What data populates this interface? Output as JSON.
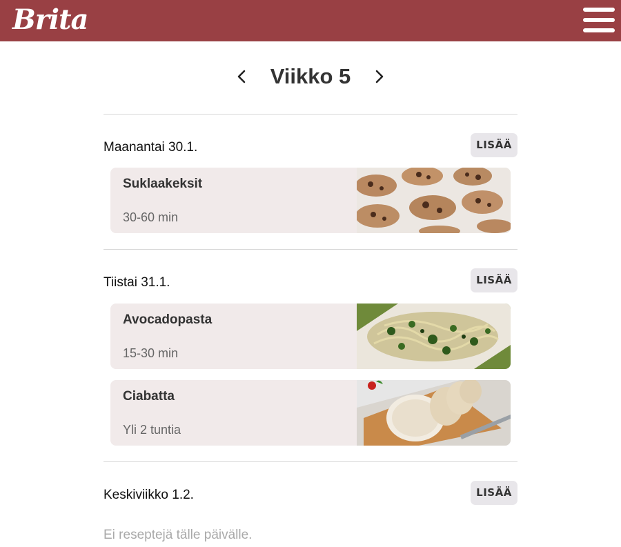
{
  "header": {
    "logo_text": "Brita",
    "menu_icon": "hamburger-menu-icon",
    "background_color": "#994044"
  },
  "week_nav": {
    "title": "Viikko 5",
    "prev_icon": "chevron-left-icon",
    "next_icon": "chevron-right-icon"
  },
  "days": [
    {
      "label": "Maanantai 30.1.",
      "add_label": "LISÄÄ",
      "recipes": [
        {
          "title": "Suklaakeksit",
          "time": "30-60 min",
          "image": "chocolate-cookies-image"
        }
      ]
    },
    {
      "label": "Tiistai 31.1.",
      "add_label": "LISÄÄ",
      "recipes": [
        {
          "title": "Avocadopasta",
          "time": "15-30 min",
          "image": "avocado-pasta-image"
        },
        {
          "title": "Ciabatta",
          "time": "Yli 2 tuntia",
          "image": "ciabatta-bread-image"
        }
      ]
    },
    {
      "label": "Keskiviikko 1.2.",
      "add_label": "LISÄÄ",
      "empty_text": "Ei reseptejä tälle päivälle."
    }
  ]
}
